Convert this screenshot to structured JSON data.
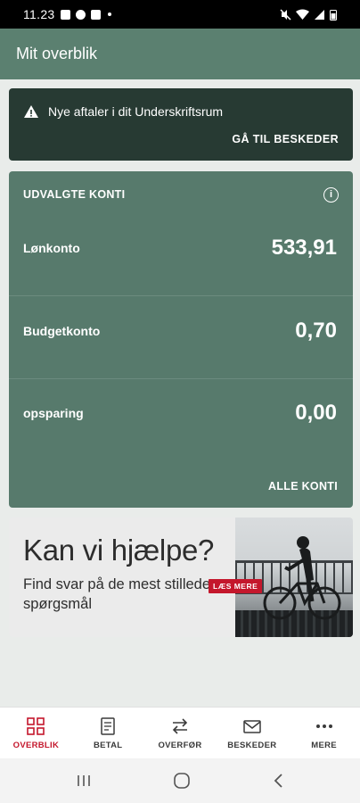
{
  "status_bar": {
    "time": "11.23"
  },
  "app_bar": {
    "title": "Mit overblik"
  },
  "alert": {
    "message": "Nye aftaler i dit Underskriftsrum",
    "action_label": "GÅ TIL BESKEDER"
  },
  "accounts": {
    "title": "UDVALGTE KONTI",
    "items": [
      {
        "name": "Lønkonto",
        "amount": "533,91"
      },
      {
        "name": "Budgetkonto",
        "amount": "0,70"
      },
      {
        "name": "opsparing",
        "amount": "0,00"
      }
    ],
    "all_label": "ALLE KONTI"
  },
  "banner": {
    "heading": "Kan vi hjælpe?",
    "subtext": "Find svar på de mest stillede spørgsmål",
    "cta_label": "LÆS MERE"
  },
  "bottom_nav": {
    "items": [
      {
        "label": "OVERBLIK",
        "icon": "overview-icon",
        "active": true
      },
      {
        "label": "BETAL",
        "icon": "pay-icon",
        "active": false
      },
      {
        "label": "OVERFØR",
        "icon": "transfer-icon",
        "active": false
      },
      {
        "label": "BESKEDER",
        "icon": "messages-icon",
        "active": false
      },
      {
        "label": "MERE",
        "icon": "more-icon",
        "active": false
      }
    ]
  },
  "colors": {
    "app_bar": "#5b8070",
    "alert_bg": "#273a33",
    "accounts_bg": "#577a6c",
    "accent_red": "#c4172c"
  }
}
